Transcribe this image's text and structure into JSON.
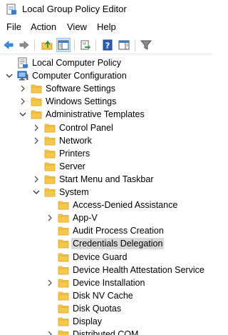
{
  "window": {
    "title": "Local Group Policy Editor",
    "icon": "group-policy-app-icon"
  },
  "menu": [
    {
      "label": "File"
    },
    {
      "label": "Action"
    },
    {
      "label": "View"
    },
    {
      "label": "Help"
    }
  ],
  "toolbar": [
    {
      "icon": "back-arrow-icon"
    },
    {
      "icon": "forward-arrow-icon"
    },
    {
      "icon": "up-folder-icon"
    },
    {
      "icon": "show-hide-console-tree-icon",
      "active": true
    },
    {
      "icon": "export-list-icon"
    },
    {
      "icon": "help-icon"
    },
    {
      "icon": "show-hide-action-pane-icon"
    },
    {
      "icon": "filter-icon"
    }
  ],
  "tree": [
    {
      "label": "Local Computer Policy",
      "icon": "policy-doc-icon",
      "expander": "none"
    },
    {
      "label": "Computer Configuration",
      "icon": "computer-icon",
      "expander": "expanded"
    },
    {
      "label": "Software Settings",
      "icon": "folder-icon",
      "expander": "collapsed"
    },
    {
      "label": "Windows Settings",
      "icon": "folder-icon",
      "expander": "collapsed"
    },
    {
      "label": "Administrative Templates",
      "icon": "folder-icon",
      "expander": "expanded"
    },
    {
      "label": "Control Panel",
      "icon": "folder-icon",
      "expander": "collapsed"
    },
    {
      "label": "Network",
      "icon": "folder-icon",
      "expander": "collapsed"
    },
    {
      "label": "Printers",
      "icon": "folder-icon",
      "expander": "none"
    },
    {
      "label": "Server",
      "icon": "folder-icon",
      "expander": "none"
    },
    {
      "label": "Start Menu and Taskbar",
      "icon": "folder-icon",
      "expander": "collapsed"
    },
    {
      "label": "System",
      "icon": "folder-icon",
      "expander": "expanded"
    },
    {
      "label": "Access-Denied Assistance",
      "icon": "folder-icon",
      "expander": "none"
    },
    {
      "label": "App-V",
      "icon": "folder-icon",
      "expander": "collapsed"
    },
    {
      "label": "Audit Process Creation",
      "icon": "folder-icon",
      "expander": "none"
    },
    {
      "label": "Credentials Delegation",
      "icon": "folder-icon",
      "expander": "none",
      "selected": true
    },
    {
      "label": "Device Guard",
      "icon": "folder-icon",
      "expander": "none"
    },
    {
      "label": "Device Health Attestation Service",
      "icon": "folder-icon",
      "expander": "none"
    },
    {
      "label": "Device Installation",
      "icon": "folder-icon",
      "expander": "collapsed"
    },
    {
      "label": "Disk NV Cache",
      "icon": "folder-icon",
      "expander": "none"
    },
    {
      "label": "Disk Quotas",
      "icon": "folder-icon",
      "expander": "none"
    },
    {
      "label": "Display",
      "icon": "folder-icon",
      "expander": "none"
    },
    {
      "label": "Distributed COM",
      "icon": "folder-icon",
      "expander": "collapsed"
    }
  ],
  "colors": {
    "selection": "#d9d9d9",
    "folder": "#f5c84c",
    "folder_dark": "#e0a82e",
    "toolbar_active": "#cce4f7"
  }
}
